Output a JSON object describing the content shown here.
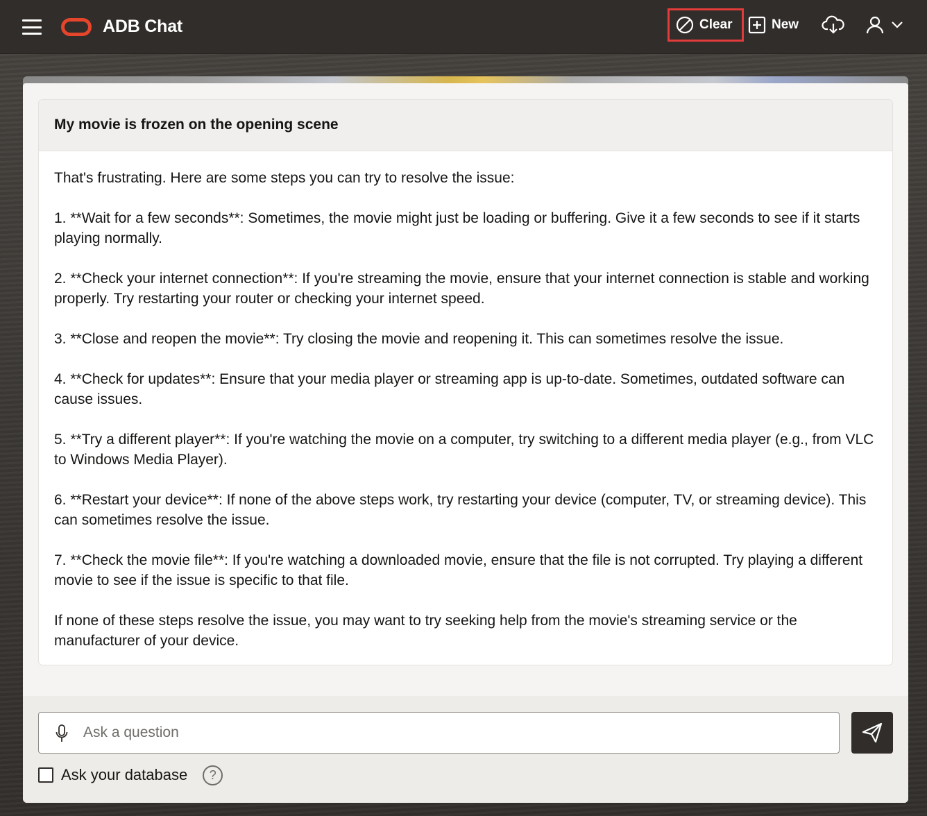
{
  "header": {
    "app_title": "ADB Chat",
    "menu_icon": "hamburger-menu-icon",
    "logo_icon": "oracle-logo-icon",
    "clear_label": "Clear",
    "new_label": "New",
    "download_icon": "cloud-download-icon",
    "user_icon": "user-icon",
    "accent_color": "#e5452a",
    "highlight_color": "#e13b3b"
  },
  "chat": {
    "question": "My movie is frozen on the opening scene",
    "answer_paragraphs": [
      "That's frustrating. Here are some steps you can try to resolve the issue:",
      "1. **Wait for a few seconds**: Sometimes, the movie might just be loading or buffering. Give it a few seconds to see if it starts playing normally.",
      "2. **Check your internet connection**: If you're streaming the movie, ensure that your internet connection is stable and working properly. Try restarting your router or checking your internet speed.",
      "3. **Close and reopen the movie**: Try closing the movie and reopening it. This can sometimes resolve the issue.",
      "4. **Check for updates**: Ensure that your media player or streaming app is up-to-date. Sometimes, outdated software can cause issues.",
      "5. **Try a different player**: If you're watching the movie on a computer, try switching to a different media player (e.g., from VLC to Windows Media Player).",
      "6. **Restart your device**: If none of the above steps work, try restarting your device (computer, TV, or streaming device). This can sometimes resolve the issue.",
      "7. **Check the movie file**: If you're watching a downloaded movie, ensure that the file is not corrupted. Try playing a different movie to see if the issue is specific to that file.",
      "If none of these steps resolve the issue, you may want to try seeking help from the movie's streaming service or the manufacturer of your device."
    ]
  },
  "input": {
    "placeholder": "Ask a question",
    "value": "",
    "mic_icon": "microphone-icon",
    "send_icon": "send-icon",
    "ask_db_label": "Ask your database",
    "ask_db_checked": false,
    "help_icon": "help-icon"
  }
}
